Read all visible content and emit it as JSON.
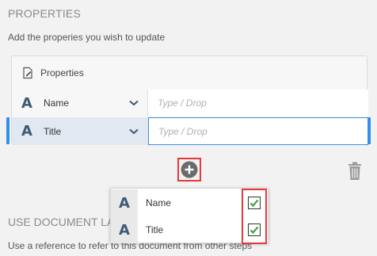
{
  "section": {
    "title": "PROPERTIES",
    "description": "Add the properies you wish to update"
  },
  "panel": {
    "header_label": "Properties",
    "rows": [
      {
        "icon": "text-type-icon",
        "label": "Name",
        "placeholder": "Type / Drop"
      },
      {
        "icon": "text-type-icon",
        "label": "Title",
        "placeholder": "Type / Drop"
      }
    ]
  },
  "popup": {
    "items": [
      {
        "icon": "text-type-icon",
        "label": "Name",
        "checked": true
      },
      {
        "icon": "text-type-icon",
        "label": "Title",
        "checked": true
      }
    ]
  },
  "section2": {
    "title": "USE DOCUMENT LAT",
    "description": "Use a reference to refer to this document from other steps"
  },
  "colors": {
    "accent_blue": "#2f8ff0",
    "highlight_red": "#e8383d",
    "type_icon": "#3e5a74",
    "check_green": "#3aa53a"
  }
}
